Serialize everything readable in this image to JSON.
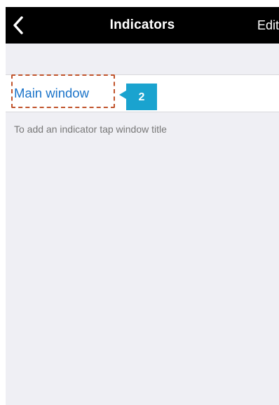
{
  "navbar": {
    "back_icon": "chevron-left-icon",
    "title": "Indicators",
    "edit_label": "Edit"
  },
  "windows": [
    {
      "label": "Main window"
    }
  ],
  "hint": "To add an indicator tap window title",
  "annotation": {
    "badge_number": "2",
    "badge_color": "#1aa3cf",
    "outline_color": "#c0532b"
  },
  "colors": {
    "navbar_background": "#000000",
    "link_blue": "#1a73c9",
    "background_gray": "#efeff4"
  }
}
